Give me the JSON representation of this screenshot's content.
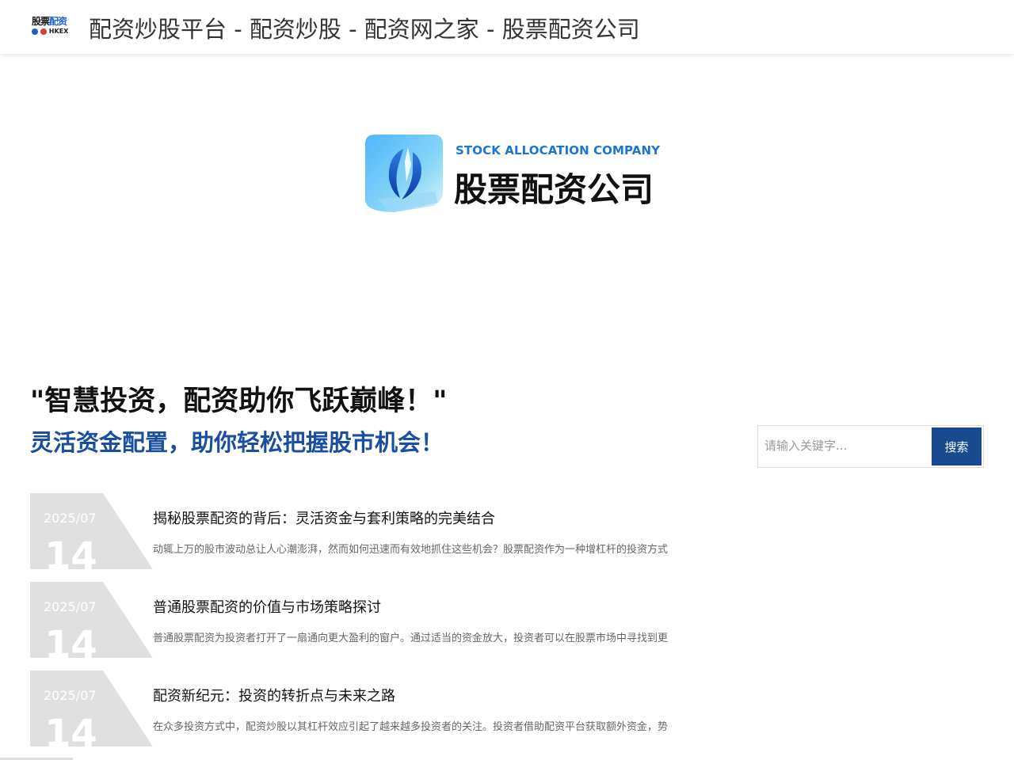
{
  "header": {
    "logo": {
      "line1_a": "股票",
      "line1_b": "配资",
      "line2": "HKEX"
    },
    "site_title": "配资炒股平台 - 配资炒股 - 配资网之家 - 股票配资公司"
  },
  "hero": {
    "en_text": "STOCK ALLOCATION COMPANY",
    "cn_text": "股票配资公司"
  },
  "slogans": {
    "line1": "\"智慧投资，配资助你飞跃巅峰！\"",
    "line2": "灵活资金配置，助你轻松把握股市机会！"
  },
  "search": {
    "placeholder": "请输入关键字...",
    "button_label": "搜索"
  },
  "posts": [
    {
      "date_ym": "2025/07",
      "date_d": "14",
      "title": "揭秘股票配资的背后：灵活资金与套利策略的完美结合",
      "excerpt": "动辄上万的股市波动总让人心潮澎湃，然而如何迅速而有效地抓住这些机会？股票配资作为一种增杠杆的投资方式"
    },
    {
      "date_ym": "2025/07",
      "date_d": "14",
      "title": "普通股票配资的价值与市场策略探讨",
      "excerpt": "普通股票配资为投资者打开了一扇通向更大盈利的窗户。通过适当的资金放大，投资者可以在股票市场中寻找到更"
    },
    {
      "date_ym": "2025/07",
      "date_d": "14",
      "title": "配资新纪元：投资的转折点与未来之路",
      "excerpt": "在众多投资方式中，配资炒股以其杠杆效应引起了越来越多投资者的关注。投资者借助配资平台获取额外资金，势"
    }
  ],
  "colors": {
    "accent": "#1a4fa0",
    "search_button": "#174a8f",
    "date_badge": "#e0e0e0",
    "hero_en": "#1976d2"
  }
}
